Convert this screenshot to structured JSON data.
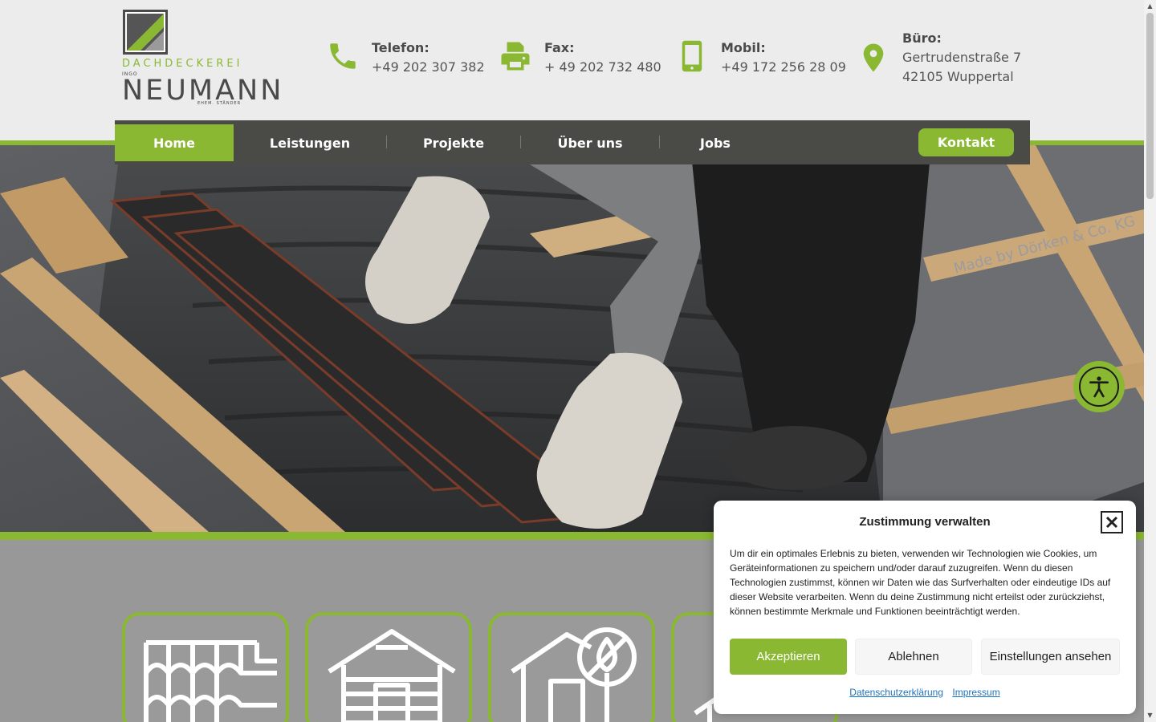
{
  "logo": {
    "line1": "DACHDECKEREI",
    "ingo": "INGO",
    "line2": "NEUMANN",
    "ehem": "EHEM. STÄNDER"
  },
  "contacts": [
    {
      "icon": "phone-icon",
      "label": "Telefon:",
      "value": "+49 202 307 382"
    },
    {
      "icon": "fax-icon",
      "label": "Fax:",
      "value": "+ 49 202 732 480"
    },
    {
      "icon": "mobile-icon",
      "label": "Mobil:",
      "value": "+49 172 256 28 09"
    },
    {
      "icon": "location-pin-icon",
      "label": "Büro:",
      "value": "Gertrudenstraße 7",
      "value2": "42105 Wuppertal"
    }
  ],
  "nav": {
    "items": [
      "Home",
      "Leistungen",
      "Projekte",
      "Über uns",
      "Jobs"
    ],
    "active": "Home",
    "cta": "Kontakt"
  },
  "colors": {
    "accent": "#8ab833",
    "nav_bg": "#4a4a47",
    "header_bg": "#ececec"
  },
  "cookie": {
    "title": "Zustimmung verwalten",
    "text": "Um dir ein optimales Erlebnis zu bieten, verwenden wir Technologien wie Cookies, um Geräteinformationen zu speichern und/oder darauf zuzugreifen. Wenn du diesen Technologien zustimmst, können wir Daten wie das Surfverhalten oder eindeutige IDs auf dieser Website verarbeiten. Wenn du deine Zustimmung nicht erteilst oder zurückziehst, können bestimmte Merkmale und Funktionen beeinträchtigt werden.",
    "accept": "Akzeptieren",
    "deny": "Ablehnen",
    "settings": "Einstellungen ansehen",
    "link_privacy": "Datenschutzerklärung",
    "link_imprint": "Impressum"
  },
  "service_icons": [
    "roof-tiles-icon",
    "house-facade-icon",
    "house-waterproof-icon",
    "roof-partial-icon"
  ]
}
